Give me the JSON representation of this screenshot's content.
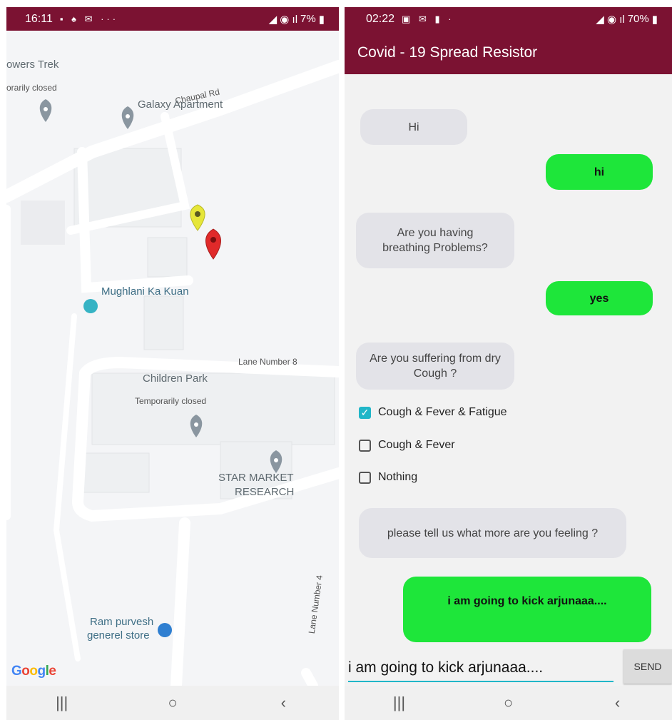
{
  "left_status": {
    "time": "16:11",
    "notif_icons": "▪ ♠ ✉ ···",
    "battery": "7%"
  },
  "right_status": {
    "time": "02:22",
    "notif_icons": "▣ ✉ ▮ ·",
    "battery": "70%"
  },
  "map": {
    "labels": {
      "trek": "owers Trek",
      "closed_top": "orarily closed",
      "galaxy": "Galaxy Apartment",
      "chaupal": "Chaupal Rd",
      "mughlani": "Mughlani Ka Kuan",
      "lane8": "Lane Number 8",
      "children_park": "Children Park",
      "temp_closed": "Temporarily closed",
      "star_market": "STAR MARKET",
      "research": "RESEARCH",
      "lane4": "Lane Number 4",
      "ram": "Ram purvesh",
      "store": "generel store"
    },
    "logo": [
      "G",
      "o",
      "o",
      "g",
      "l",
      "e"
    ]
  },
  "chat": {
    "title": "Covid - 19 Spread Resistor",
    "messages": {
      "m1": "Hi",
      "m2": "hi",
      "m3": "Are you having breathing Problems?",
      "m4": "yes",
      "m5": "Are you suffering from dry Cough ?",
      "m6": "please tell us what more are you feeling ?",
      "m7": "i am going to kick arjunaaa...."
    },
    "options": [
      {
        "label": "Cough & Fever & Fatigue",
        "checked": true
      },
      {
        "label": "Cough & Fever",
        "checked": false
      },
      {
        "label": "Nothing",
        "checked": false
      }
    ],
    "input_value": "i am going to kick arjunaaa....",
    "send_label": "SEND"
  },
  "nav": {
    "recents": "|||",
    "home": "○",
    "back": "‹"
  },
  "colors": {
    "appbar": "#7b1232",
    "user_bubble": "#1ee63a",
    "accent": "#21b6c8"
  }
}
